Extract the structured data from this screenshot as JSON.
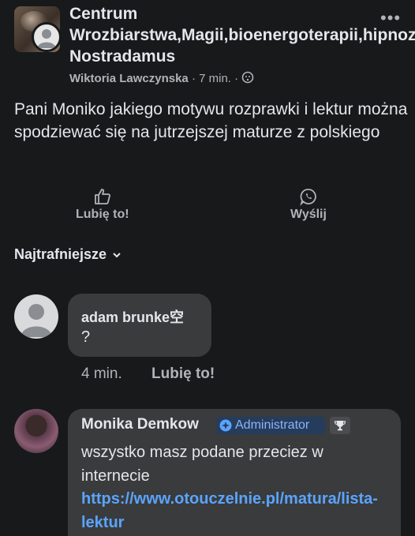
{
  "post": {
    "group_name": "Centrum Wrozbiarstwa,Magii,bioenergoterapii,hipnozy Nostradamus",
    "author": "Wiktoria Lawczynska",
    "time": "7 min.",
    "separator": "·",
    "text": "Pani Moniko jakiego motywu rozprawki i lektur można spodziewać się na jutrzejszej maturze z polskiego"
  },
  "actions": {
    "like_label": "Lubię to!",
    "send_label": "Wyślij"
  },
  "sort": {
    "label": "Najtrafniejsze"
  },
  "comments": [
    {
      "author": "adam brunke空",
      "text": "?",
      "time": "4 min.",
      "like_label": "Lubię to!"
    },
    {
      "author": "Monika Demkow",
      "badge": "Administrator",
      "text": "wszystko masz podane przeciez w internecie",
      "link": "https://www.otouczelnie.pl/matura/lista-lektur"
    }
  ],
  "colors": {
    "background": "#18191a",
    "bubble": "#3a3b3c",
    "link": "#5aa4ff",
    "admin_text": "#8ab4f8"
  }
}
